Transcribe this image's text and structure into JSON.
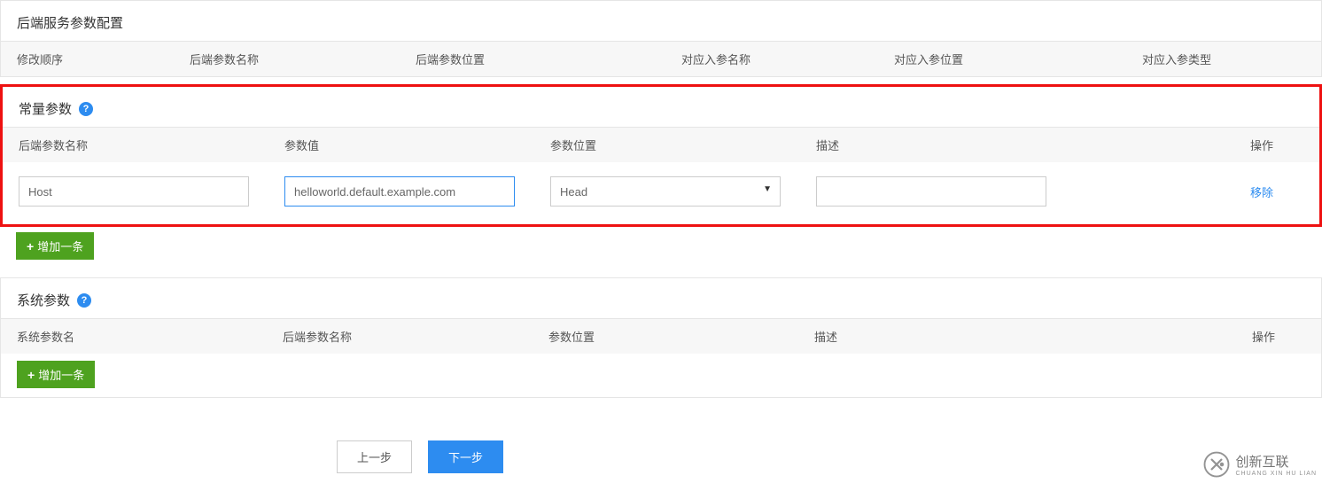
{
  "section_backend": {
    "title": "后端服务参数配置",
    "headers": {
      "order": "修改顺序",
      "backend_name": "后端参数名称",
      "backend_pos": "后端参数位置",
      "in_name": "对应入参名称",
      "in_pos": "对应入参位置",
      "in_type": "对应入参类型"
    }
  },
  "section_const": {
    "title": "常量参数",
    "headers": {
      "backend_name": "后端参数名称",
      "value": "参数值",
      "pos": "参数位置",
      "desc": "描述",
      "op": "操作"
    },
    "row": {
      "name": "Host",
      "value": "helloworld.default.example.com",
      "pos_selected": "Head",
      "desc": "",
      "remove": "移除"
    }
  },
  "section_sys": {
    "title": "系统参数",
    "headers": {
      "sys_name": "系统参数名",
      "backend_name": "后端参数名称",
      "pos": "参数位置",
      "desc": "描述",
      "op": "操作"
    }
  },
  "buttons": {
    "add": "增加一条",
    "prev": "上一步",
    "next": "下一步"
  },
  "watermark": {
    "text": "创新互联",
    "sub": "CHUANG XIN HU LIAN"
  }
}
